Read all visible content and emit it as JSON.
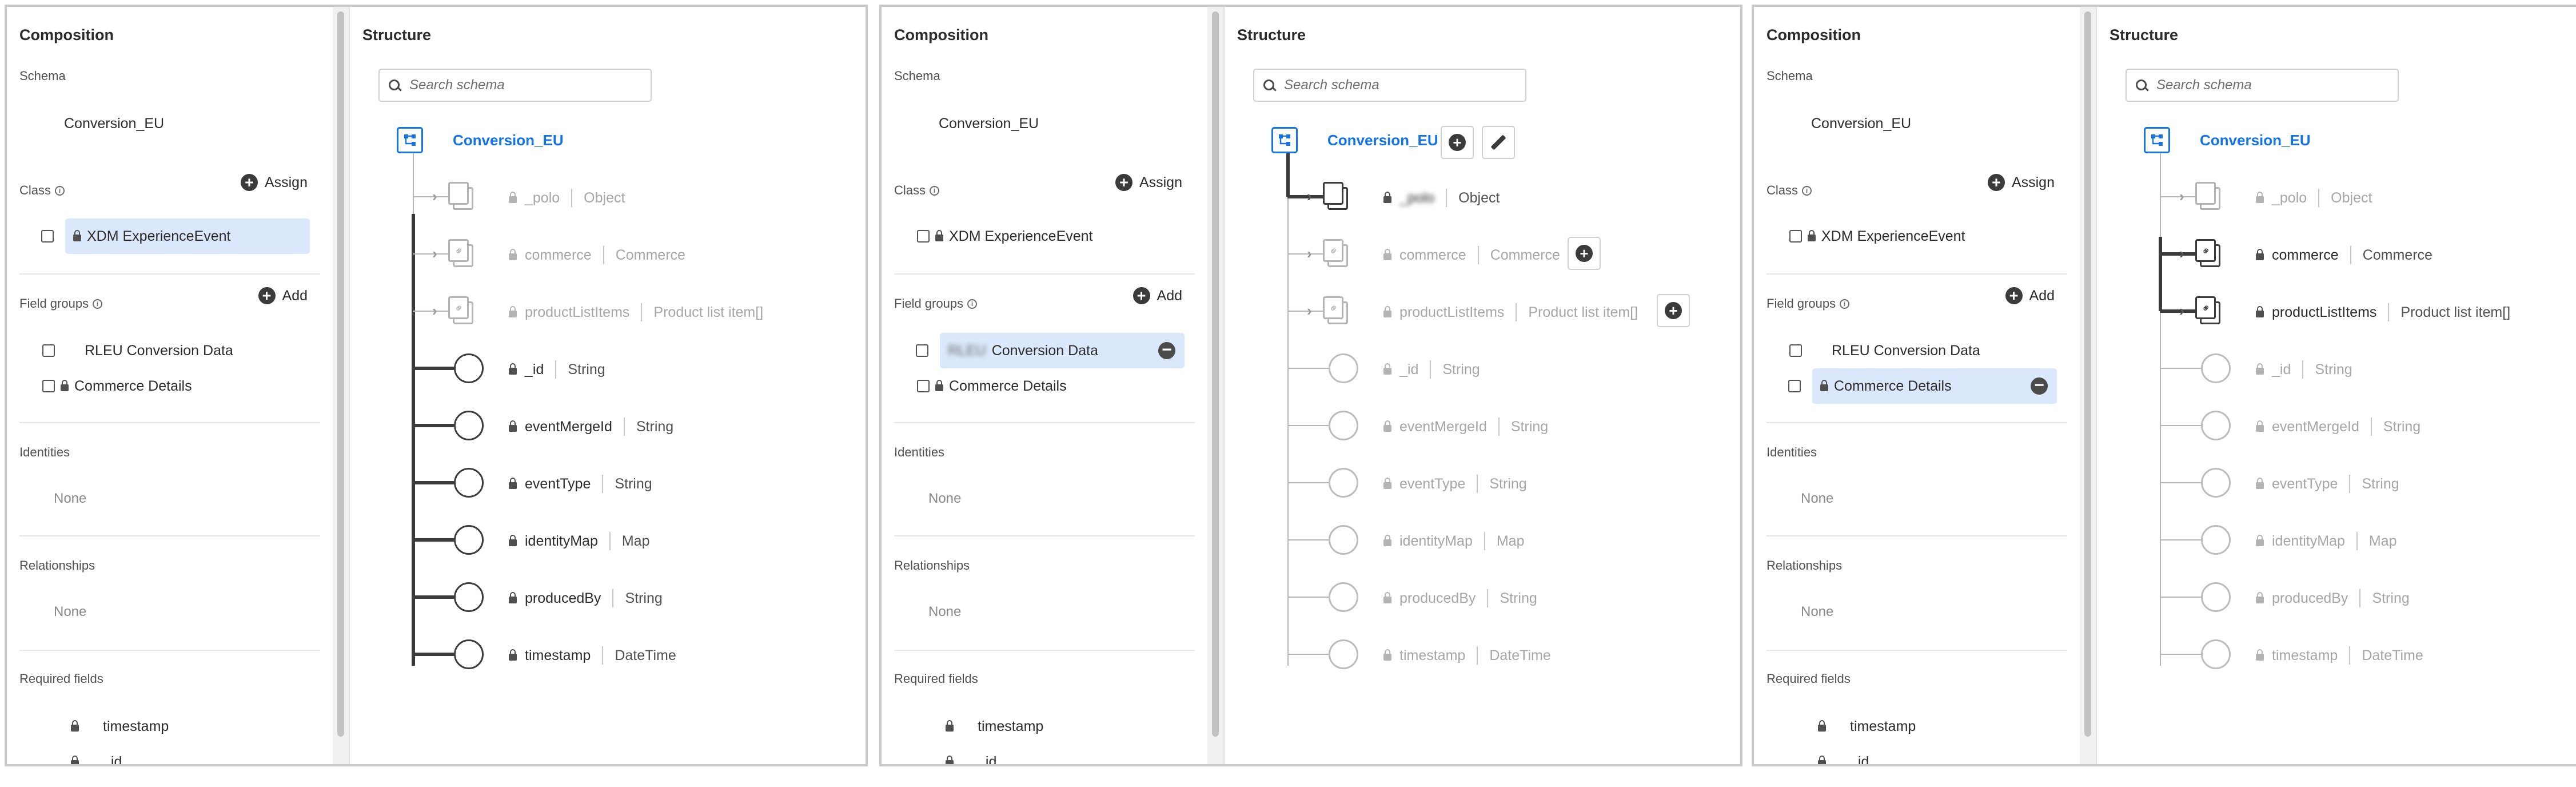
{
  "composition": {
    "title": "Composition",
    "schema_label": "Schema",
    "schema_name": "Conversion_EU",
    "class_label": "Class",
    "class_assign": "Assign",
    "class_item": "XDM ExperienceEvent",
    "fieldgroups_label": "Field groups",
    "fieldgroups_add": "Add",
    "fieldgroup_conversion": "RLEU Conversion Data",
    "fieldgroup_conversion_blurred_prefix": "RLEU",
    "fieldgroup_conversion_suffix": "Conversion Data",
    "fieldgroup_commerce": "Commerce Details",
    "identities_label": "Identities",
    "identities_value": "None",
    "relationships_label": "Relationships",
    "relationships_value": "None",
    "required_label": "Required fields",
    "required_fields": [
      "timestamp",
      "_id"
    ]
  },
  "structure": {
    "title": "Structure",
    "search_placeholder": "Search schema",
    "root": "Conversion_EU",
    "fields": [
      {
        "name": "_polo",
        "type": "Object"
      },
      {
        "name": "commerce",
        "type": "Commerce"
      },
      {
        "name": "productListItems",
        "type": "Product list item[]"
      },
      {
        "name": "_id",
        "type": "String"
      },
      {
        "name": "eventMergeId",
        "type": "String"
      },
      {
        "name": "eventType",
        "type": "String"
      },
      {
        "name": "identityMap",
        "type": "Map"
      },
      {
        "name": "producedBy",
        "type": "String"
      },
      {
        "name": "timestamp",
        "type": "DateTime"
      }
    ]
  },
  "colors": {
    "accent": "#1473e6",
    "selection": "#dbe8fb",
    "tree_dark": "#3b3b3b",
    "tree_faint": "#b6b6b6"
  },
  "icons": [
    "info-icon",
    "plus-icon",
    "minus-icon",
    "lock-icon",
    "search-icon",
    "schema-root-icon",
    "object-icon",
    "link-icon",
    "field-circle-icon",
    "chevron-right-icon",
    "pencil-icon"
  ]
}
